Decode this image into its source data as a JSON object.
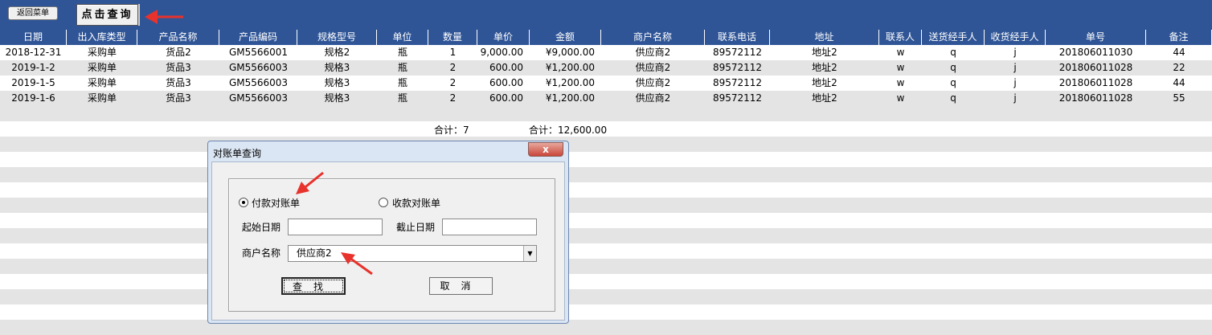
{
  "toolbar": {
    "back_label": "返回菜单",
    "query_label": "点击查询"
  },
  "columns": [
    "日期",
    "出入库类型",
    "产品名称",
    "产品编码",
    "规格型号",
    "单位",
    "数量",
    "单价",
    "金额",
    "商户名称",
    "联系电话",
    "地址",
    "联系人",
    "送货经手人",
    "收货经手人",
    "单号",
    "备注"
  ],
  "rows": [
    [
      "2018-12-31",
      "采购单",
      "货品2",
      "GM5566001",
      "规格2",
      "瓶",
      "1",
      "9,000.00",
      "¥9,000.00",
      "供应商2",
      "89572112",
      "地址2",
      "w",
      "q",
      "j",
      "201806011030",
      "44"
    ],
    [
      "2019-1-2",
      "采购单",
      "货品3",
      "GM5566003",
      "规格3",
      "瓶",
      "2",
      "600.00",
      "¥1,200.00",
      "供应商2",
      "89572112",
      "地址2",
      "w",
      "q",
      "j",
      "201806011028",
      "22"
    ],
    [
      "2019-1-5",
      "采购单",
      "货品3",
      "GM5566003",
      "规格3",
      "瓶",
      "2",
      "600.00",
      "¥1,200.00",
      "供应商2",
      "89572112",
      "地址2",
      "w",
      "q",
      "j",
      "201806011028",
      "44"
    ],
    [
      "2019-1-6",
      "采购单",
      "货品3",
      "GM5566003",
      "规格3",
      "瓶",
      "2",
      "600.00",
      "¥1,200.00",
      "供应商2",
      "89572112",
      "地址2",
      "w",
      "q",
      "j",
      "201806011028",
      "55"
    ]
  ],
  "totals": {
    "qty": "合计：7",
    "amount": "合计：12,600.00"
  },
  "dialog": {
    "title": "对账单查询",
    "close_label": "x",
    "radio_pay": "付款对账单",
    "radio_receive": "收款对账单",
    "start_date_label": "起始日期",
    "end_date_label": "截止日期",
    "start_date_value": "",
    "end_date_value": "",
    "merchant_label": "商户名称",
    "merchant_value": "供应商2",
    "find_label": "查找",
    "cancel_label": "取消"
  },
  "colors": {
    "header_bg": "#2f5597",
    "stripe": "#e4e4e4",
    "annotation": "#e8322c"
  }
}
